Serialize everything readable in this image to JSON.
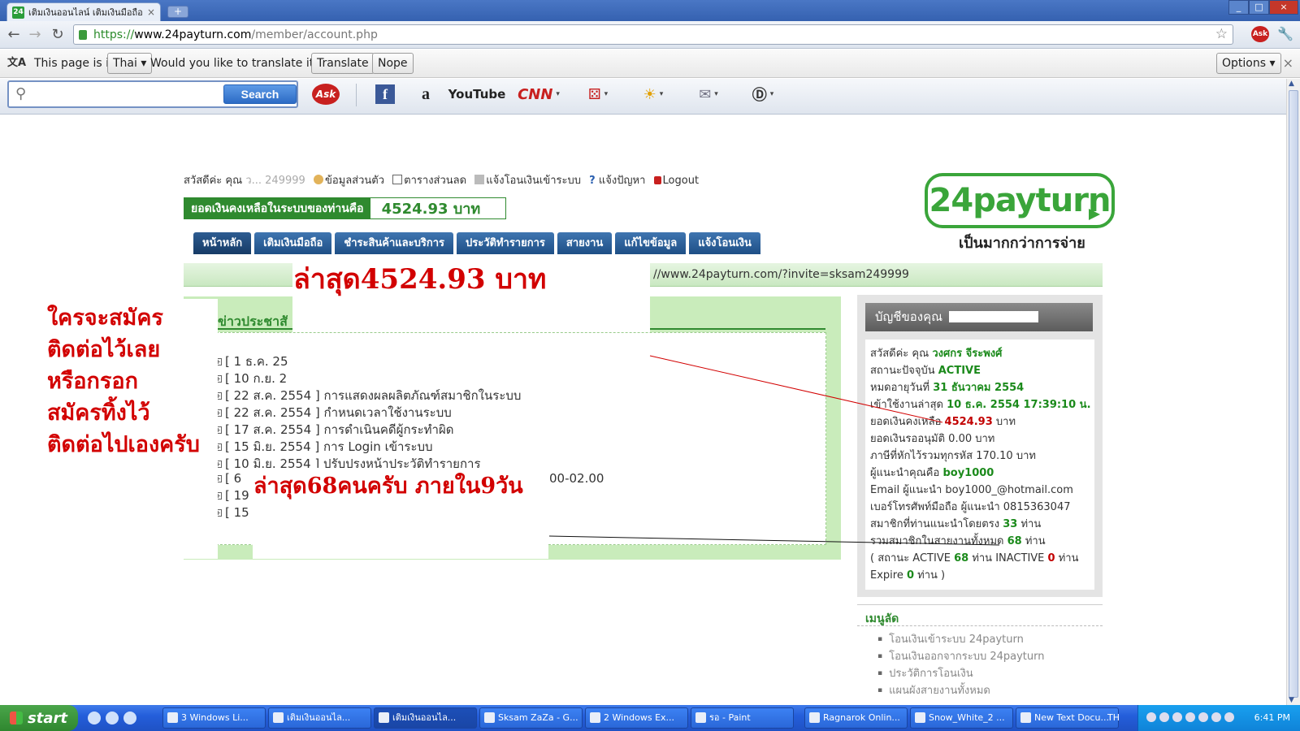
{
  "browser": {
    "tab_title": "เติมเงินออนไลน์ เติมเงินมือถือ",
    "tab_favicon": "24",
    "tab_close": "×",
    "newtab": "+",
    "url_scheme": "https://",
    "url_host": "www.24payturn.com",
    "url_path": "/member/account.php"
  },
  "translate_bar": {
    "prefix": "This page is in",
    "language": "Thai ▾",
    "question": "Would you like to translate it?",
    "translate_label": "Translate",
    "nope_label": "Nope",
    "options_label": "Options ▾",
    "close": "×"
  },
  "ask_toolbar": {
    "search_placeholder": "",
    "search_label": "Search",
    "icons": [
      "ask-icon",
      "facebook-icon",
      "amazon-icon",
      "youtube-icon",
      "cnn-icon",
      "games-icon",
      "weather-icon",
      "mail-icon",
      "dictionary-icon"
    ],
    "ask_text": "Ask",
    "youtube_text": "YouTube",
    "cnn_text": "CNN"
  },
  "page": {
    "greeting_prefix": "สวัสดีค่ะ คุณ",
    "greeting_masked": "ว...  249999",
    "links": [
      "ข้อมูลส่วนตัว",
      "ตารางส่วนลด",
      "แจ้งโอนเงินเข้าระบบ",
      "แจ้งปัญหา",
      "Logout"
    ],
    "balance_label": "ยอดเงินคงเหลือในระบบของท่านคือ",
    "balance_value": "4524.93 บาท",
    "logo_text": "24payturn",
    "logo_tagline": "เป็นมากกว่าการจ่าย",
    "nav": [
      "หน้าหลัก",
      "เติมเงินมือถือ",
      "ชำระสินค้าและบริการ",
      "ประวัติทำรายการ",
      "สายงาน",
      "แก้ไขข้อมูล",
      "แจ้งโอนเงิน"
    ],
    "invite_text": "//www.24payturn.com/?invite=sksam249999",
    "news_head": "ข่าวประชาสั",
    "news": [
      "[ 1 ธ.ค. 25",
      "[ 10 ก.ย. 2",
      "[ 22 ส.ค. 2554 ] การแสดงผลผลิตภัณฑ์สมาชิกในระบบ",
      "[ 22 ส.ค. 2554 ] กำหนดเวลาใช้งานระบบ",
      "[ 17 ส.ค. 2554 ] การดำเนินคดีผู้กระทำผิด",
      "[ 15 มิ.ย. 2554 ] การ Login เข้าระบบ",
      "[ 10 มิ.ย. 2554 ] ปรับปรุงหน้าประวัติทำรายการ",
      "[ 6 ",
      "[ 19",
      "[ 15"
    ],
    "news_extra": "00-02.00",
    "overlay_top": "ล่าสุด4524.93  บาท",
    "overlay_bottom": "ล่าสุด68คนครับ ภายใน9วัน",
    "left_note": "ใครจะสมัคร\nติดต่อไว้เลย\nหรือกรอก\nสมัครทิ้งไว้\nติดต่อไปเองครับ"
  },
  "account": {
    "title": "บัญชีของคุณ",
    "lines": {
      "hello_label": "สวัสดีค่ะ คุณ",
      "hello_name": "วงศกร จีระพงศ์",
      "status_label": "สถานะปัจจุบัน",
      "status_value": "ACTIVE",
      "expire_label": "หมดอายุวันที่",
      "expire_value": "31 ธันวาคม 2554",
      "last_login_label": "เข้าใช้งานล่าสุด",
      "last_login_value": "10 ธ.ค. 2554 17:39:10 น.",
      "balance_label": "ยอดเงินคงเหลือ",
      "balance_value": "4524.93",
      "baht": "บาท",
      "pending": "ยอดเงินรออนุมัติ 0.00 บาท",
      "tax": "ภาษีที่หักไว้รวมทุกรหัส 170.10 บาท",
      "referrer_label": "ผู้แนะนำคุณคือ",
      "referrer_value": "boy1000",
      "ref_email": "Email ผู้แนะนำ boy1000_@hotmail.com",
      "ref_phone": "เบอร์โทรศัพท์มือถือ ผู้แนะนำ 0815363047",
      "direct_label": "สมาชิกที่ท่านแนะนำโดยตรง",
      "direct_value": "33",
      "people": "ท่าน",
      "total_label": "รวมสมาชิกในสายงานทั้งหมด",
      "total_value": "68",
      "status_active_label": "( สถานะ ACTIVE",
      "active_value": "68",
      "inactive_label": "ท่าน INACTIVE",
      "inactive_value": "0",
      "expire_count_label": "Expire",
      "expire_count_value": "0",
      "close_paren": "ท่าน )"
    },
    "menu_title": "เมนูลัด",
    "menu": [
      "โอนเงินเข้าระบบ 24payturn",
      "โอนเงินออกจากระบบ 24payturn",
      "ประวัติการโอนเงิน",
      "แผนผังสายงานทั้งหมด"
    ]
  },
  "taskbar": {
    "start_label": "start",
    "tasks": [
      "3 Windows Li...",
      "เติมเงินออนไล...",
      "เติมเงินออนไล...",
      "Sksam ZaZa - G...",
      "2 Windows Ex...",
      "รอ - Paint",
      "Ragnarok Onlin...",
      "Snow_White_2 ...",
      "New Text Docu..."
    ],
    "lang": "TH",
    "clock": "6:41 PM"
  },
  "colors": {
    "brand_green": "#3aa53a",
    "nav_blue": "#1e4f86",
    "annotation_red": "#d20000"
  }
}
